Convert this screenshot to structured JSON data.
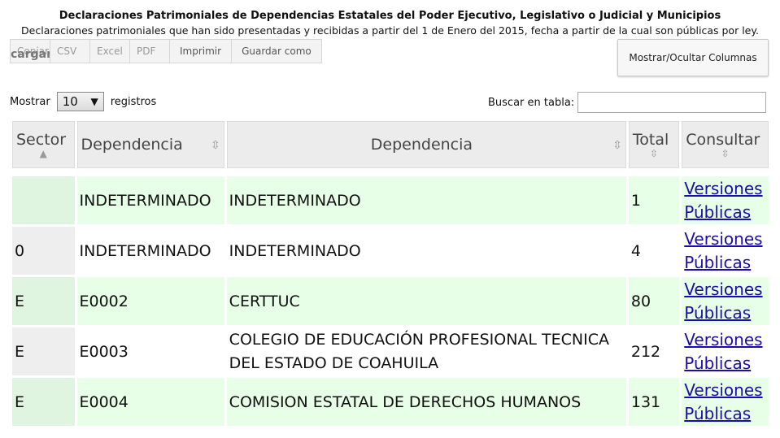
{
  "header": {
    "title": "Declaraciones Patrimoniales de Dependencias Estatales del Poder Ejecutivo, Legislativo o Judicial y Municipios",
    "subtitle": "Declaraciones patrimoniales que han sido presentadas y recibidas a partir del 1 de Enero del 2015, fecha a partir de la cual son públicas por ley."
  },
  "toolbar": {
    "copy": "Copiar",
    "csv": "CSV",
    "excel": "Excel",
    "pdf": "PDF",
    "print": "Imprimir",
    "save": "Guardar como",
    "loading_ghost": "cargar cargar cargar cargar c"
  },
  "columns_button": "Mostrar/Ocultar Columnas",
  "length": {
    "prefix": "Mostrar",
    "value": "10",
    "suffix": "registros"
  },
  "search": {
    "label": "Buscar en tabla:",
    "value": ""
  },
  "table": {
    "headers": [
      "Sector",
      "Dependencia",
      "Dependencia",
      "Total",
      "Consultar"
    ],
    "rows": [
      {
        "sector": "",
        "code": "INDETERMINADO",
        "name": "INDETERMINADO",
        "total": "1",
        "link": "Versiones Públicas"
      },
      {
        "sector": "0",
        "code": "INDETERMINADO",
        "name": "INDETERMINADO",
        "total": "4",
        "link": "Versiones Públicas"
      },
      {
        "sector": "E",
        "code": "E0002",
        "name": "CERTTUC",
        "total": "80",
        "link": "Versiones Públicas"
      },
      {
        "sector": "E",
        "code": "E0003",
        "name": "COLEGIO DE EDUCACIÓN PROFESIONAL TECNICA DEL ESTADO DE COAHUILA",
        "total": "212",
        "link": "Versiones Públicas"
      },
      {
        "sector": "E",
        "code": "E0004",
        "name": "COMISION ESTATAL DE DERECHOS HUMANOS",
        "total": "131",
        "link": "Versiones Públicas"
      }
    ]
  }
}
